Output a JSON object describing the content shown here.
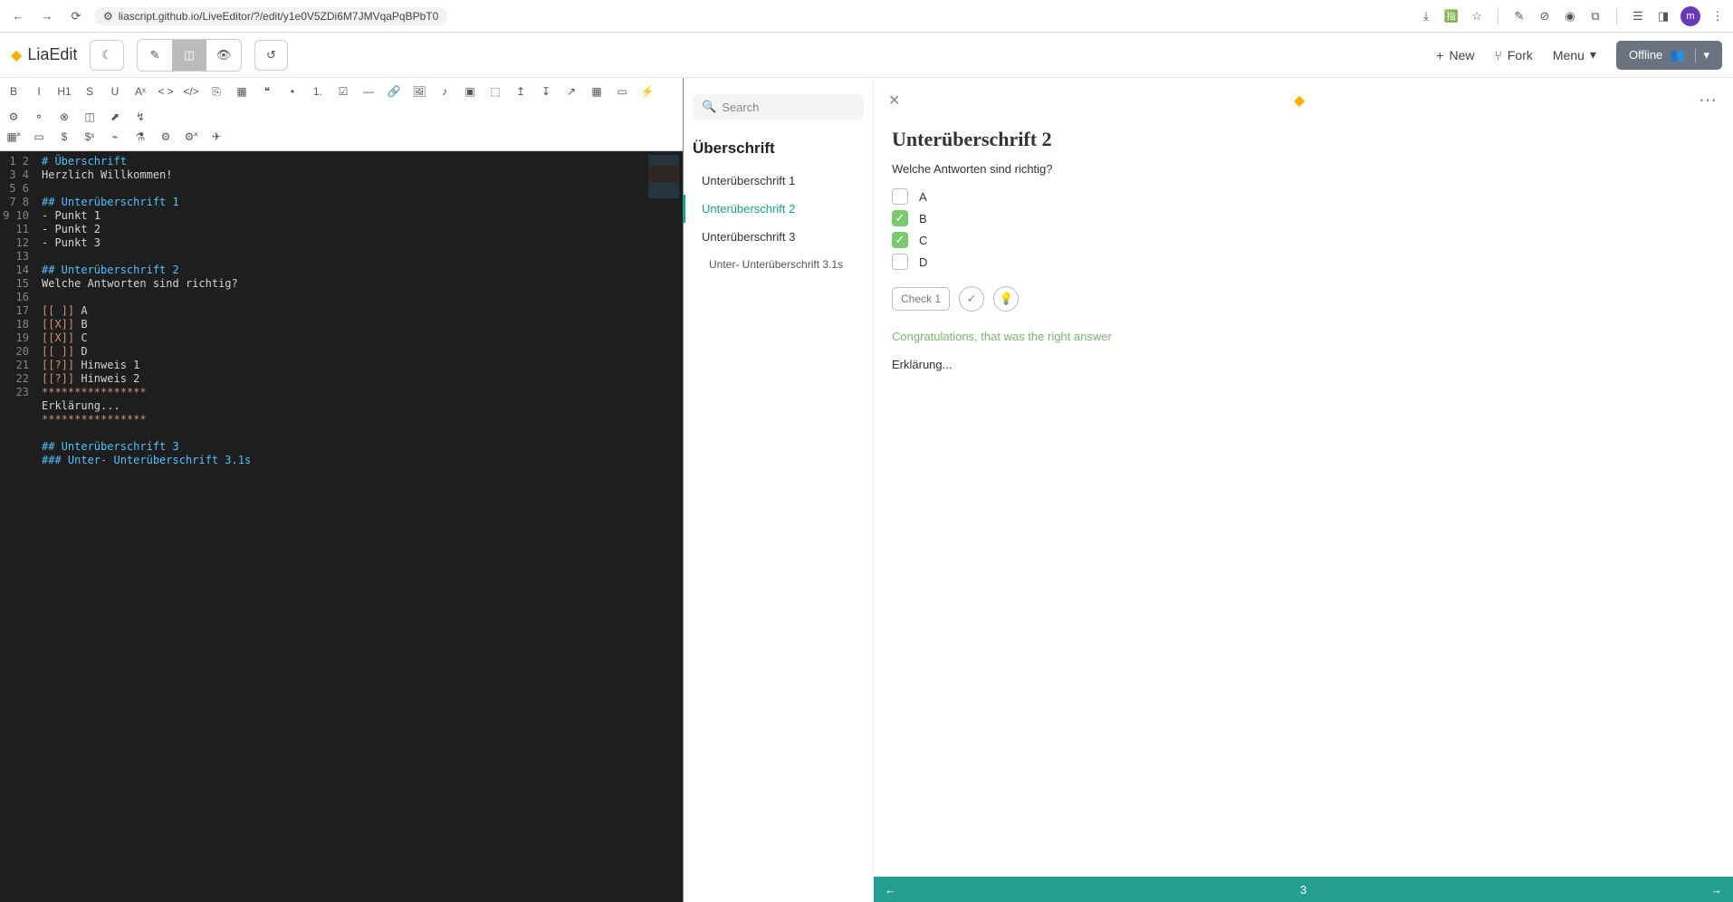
{
  "browser": {
    "url": "liascript.github.io/LiveEditor/?/edit/y1e0V5ZDi6M7JMVqaPqBPbT0",
    "avatar": "m"
  },
  "header": {
    "logo": "LiaEdit",
    "new_label": "New",
    "fork_label": "Fork",
    "menu_label": "Menu",
    "offline_label": "Offline"
  },
  "toolbar_row1": [
    "B",
    "I",
    "H1",
    "S",
    "U",
    "Aˣ",
    "< >",
    "</>",
    "⎘",
    "▦",
    "❝",
    "•",
    "1.",
    "☑",
    "—",
    "🔗",
    "🖼",
    "♪",
    "▣",
    "⬚",
    "↥",
    "↧",
    "↗",
    "▦",
    "▭",
    "⚡",
    "⚙",
    "⚬",
    "⊗",
    "◫",
    "⬈",
    "↯"
  ],
  "toolbar_row2": [
    "▦˟",
    "▭",
    "$",
    "$ˢ",
    "⌁",
    "⚗",
    "⚙",
    "⚙˟",
    "✈"
  ],
  "editor": {
    "lines": [
      {
        "n": 1,
        "h": "# Überschrift",
        "t": ""
      },
      {
        "n": 2,
        "h": "",
        "t": "Herzlich Willkommen!"
      },
      {
        "n": 3,
        "h": "",
        "t": ""
      },
      {
        "n": 4,
        "h": "## Unterüberschrift 1",
        "t": ""
      },
      {
        "n": 5,
        "h": "",
        "t": "- Punkt 1"
      },
      {
        "n": 6,
        "h": "",
        "t": "- Punkt 2"
      },
      {
        "n": 7,
        "h": "",
        "t": "- Punkt 3"
      },
      {
        "n": 8,
        "h": "",
        "t": ""
      },
      {
        "n": 9,
        "h": "## Unterüberschrift 2",
        "t": ""
      },
      {
        "n": 10,
        "h": "",
        "t": "Welche Antworten sind richtig?"
      },
      {
        "n": 11,
        "h": "",
        "t": ""
      },
      {
        "n": 12,
        "h": "",
        "k": "[[ ]]",
        "t": " A"
      },
      {
        "n": 13,
        "h": "",
        "k": "[[X]]",
        "t": " B"
      },
      {
        "n": 14,
        "h": "",
        "k": "[[X]]",
        "t": " C"
      },
      {
        "n": 15,
        "h": "",
        "k": "[[ ]]",
        "t": " D"
      },
      {
        "n": 16,
        "h": "",
        "k": "[[?]]",
        "t": " Hinweis 1"
      },
      {
        "n": 17,
        "h": "",
        "k": "[[?]]",
        "t": " Hinweis 2"
      },
      {
        "n": 18,
        "h": "",
        "s": "****************"
      },
      {
        "n": 19,
        "h": "",
        "t": "Erklärung..."
      },
      {
        "n": 20,
        "h": "",
        "s": "****************"
      },
      {
        "n": 21,
        "h": "",
        "t": ""
      },
      {
        "n": 22,
        "h": "## Unterüberschrift 3",
        "t": ""
      },
      {
        "n": 23,
        "h": "### Unter- Unterüberschrift 3.1s",
        "t": ""
      }
    ]
  },
  "toc": {
    "search_placeholder": "Search",
    "title": "Überschrift",
    "items": [
      {
        "label": "Unterüberschrift 1",
        "active": false
      },
      {
        "label": "Unterüberschrift 2",
        "active": true
      },
      {
        "label": "Unterüberschrift 3",
        "active": false
      }
    ],
    "sub": "Unter- Unterüberschrift 3.1s"
  },
  "preview": {
    "title": "Unterüberschrift 2",
    "question": "Welche Antworten sind richtig?",
    "options": [
      {
        "label": "A",
        "checked": false
      },
      {
        "label": "B",
        "checked": true
      },
      {
        "label": "C",
        "checked": true
      },
      {
        "label": "D",
        "checked": false
      }
    ],
    "check_label": "Check 1",
    "congrats": "Congratulations, that was the right answer",
    "explanation": "Erklärung...",
    "page": "3"
  }
}
